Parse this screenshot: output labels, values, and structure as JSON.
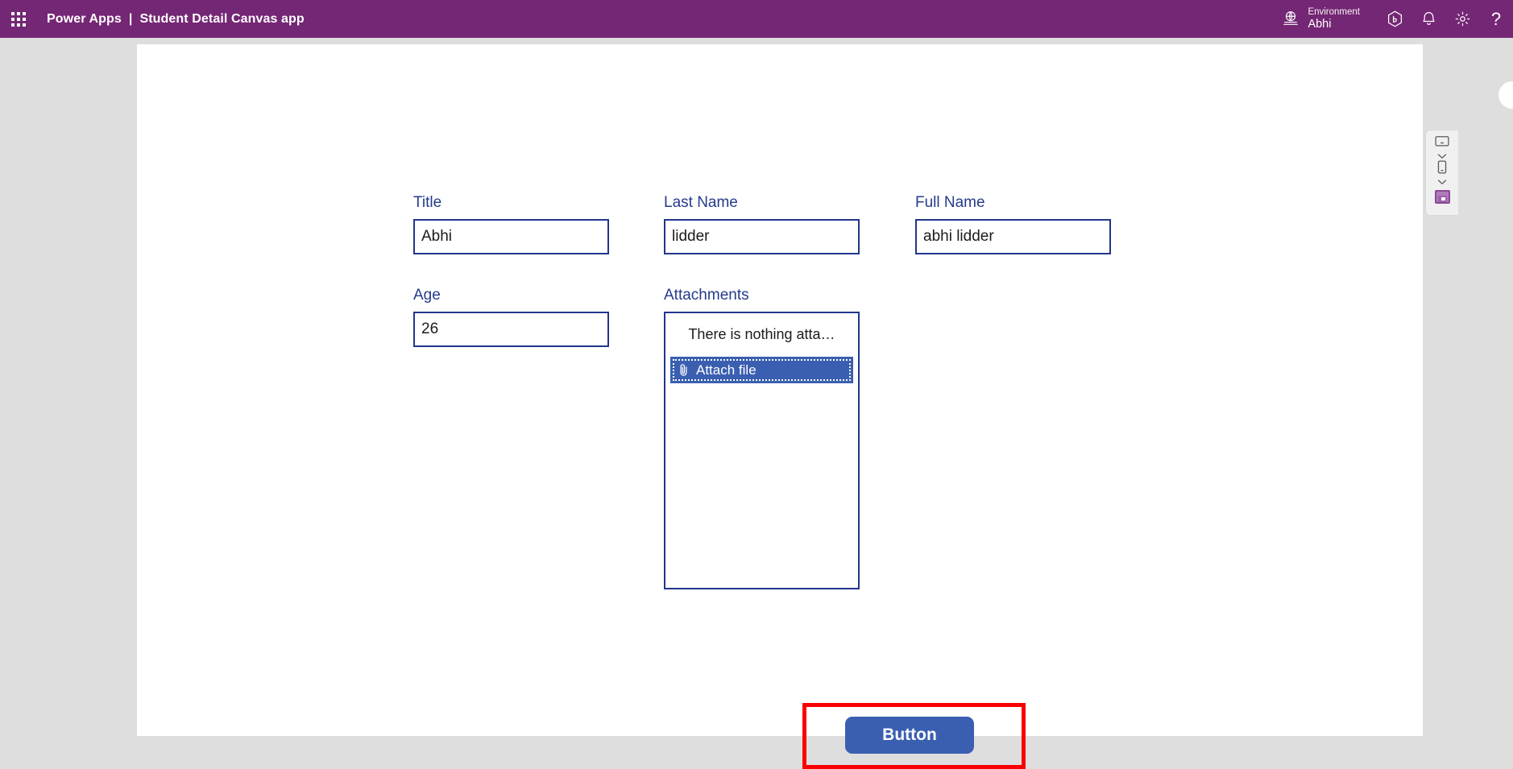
{
  "header": {
    "waffle_icon": "app-launcher-waffle-icon",
    "product": "Power Apps",
    "separator": "|",
    "app_title": "Student Detail Canvas app",
    "environment_icon": "environment-globe-icon",
    "environment_label": "Environment",
    "environment_name": "Abhi",
    "icons": [
      {
        "name": "preview-badge-icon",
        "glyph": "hexagon-badge"
      },
      {
        "name": "notifications-bell-icon",
        "glyph": "bell"
      },
      {
        "name": "settings-gear-icon",
        "glyph": "gear"
      },
      {
        "name": "help-icon",
        "glyph": "?"
      }
    ],
    "colors": {
      "bar": "#742774",
      "text": "#ffffff"
    }
  },
  "form": {
    "fields": [
      {
        "label": "Title",
        "value": "Abhi"
      },
      {
        "label": "Last Name",
        "value": "lidder"
      },
      {
        "label": "Full Name",
        "value": "abhi lidder"
      },
      {
        "label": "Age",
        "value": "26"
      }
    ],
    "attachments": {
      "label": "Attachments",
      "empty_text": "There is nothing atta…",
      "attach_button_label": "Attach file",
      "attach_button_icon": "paperclip-icon",
      "focused": true
    },
    "colors": {
      "label": "#253B8B",
      "border": "#22368A",
      "value": "#1b1b1b"
    }
  },
  "action": {
    "button_label": "Button",
    "button_color": "#3a5fb0",
    "annotation_color": "#fa0000"
  },
  "device_rail": {
    "items": [
      {
        "name": "monitor-preview-icon"
      },
      {
        "name": "monitor-size-chevron-icon"
      },
      {
        "name": "phone-preview-icon"
      },
      {
        "name": "phone-size-chevron-icon"
      },
      {
        "name": "screen-preview-active-icon"
      }
    ]
  }
}
